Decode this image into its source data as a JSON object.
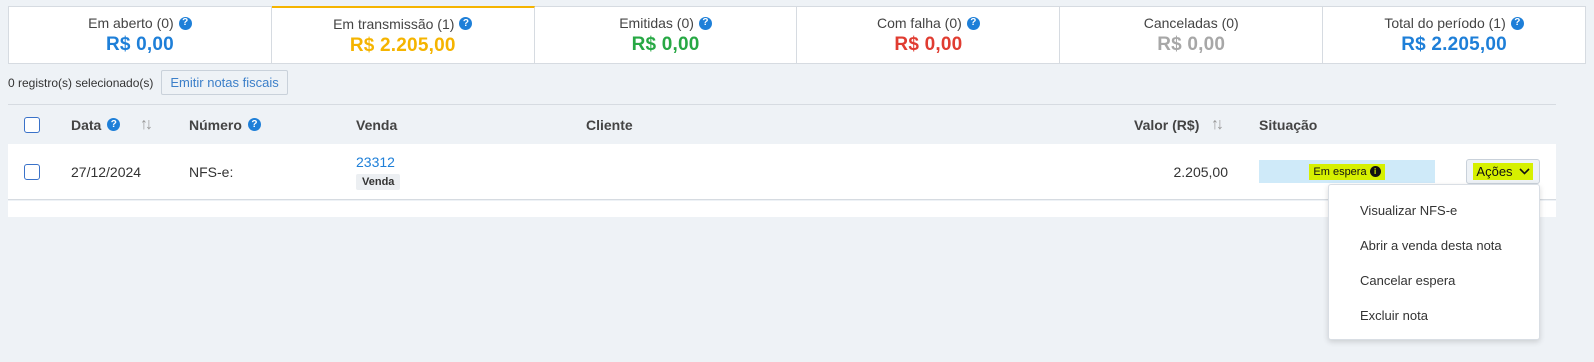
{
  "summary": {
    "cards": [
      {
        "label": "Em aberto (0)",
        "value": "R$ 0,00",
        "color": "#1e7fd8",
        "help": true
      },
      {
        "label": "Em transmissão (1)",
        "value": "R$ 2.205,00",
        "color": "#f5b400",
        "help": true
      },
      {
        "label": "Emitidas (0)",
        "value": "R$ 0,00",
        "color": "#27a844",
        "help": true
      },
      {
        "label": "Com falha (0)",
        "value": "R$ 0,00",
        "color": "#e03c31",
        "help": true
      },
      {
        "label": "Canceladas (0)",
        "value": "R$ 0,00",
        "color": "#a7a7a7",
        "help": false
      },
      {
        "label": "Total do período (1)",
        "value": "R$ 2.205,00",
        "color": "#1e7fd8",
        "help": true
      }
    ]
  },
  "selection": {
    "text": "0 registro(s) selecionado(s)",
    "emit_label": "Emitir notas fiscais"
  },
  "table": {
    "headers": {
      "data": "Data",
      "numero": "Número",
      "venda": "Venda",
      "cliente": "Cliente",
      "valor": "Valor (R$)",
      "situacao": "Situação"
    },
    "rows": [
      {
        "data": "27/12/2024",
        "numero": "NFS-e:",
        "venda_id": "23312",
        "venda_tag": "Venda",
        "cliente": "",
        "valor": "2.205,00",
        "situacao": "Em espera",
        "acoes": "Ações"
      }
    ]
  },
  "dropdown": {
    "items": [
      "Visualizar NFS-e",
      "Abrir a venda desta nota",
      "Cancelar espera",
      "Excluir nota"
    ]
  },
  "icons": {
    "help": "question-circle-icon",
    "sort": "sort-arrows-icon",
    "info": "info-circle-icon",
    "chevron": "chevron-down-icon"
  }
}
